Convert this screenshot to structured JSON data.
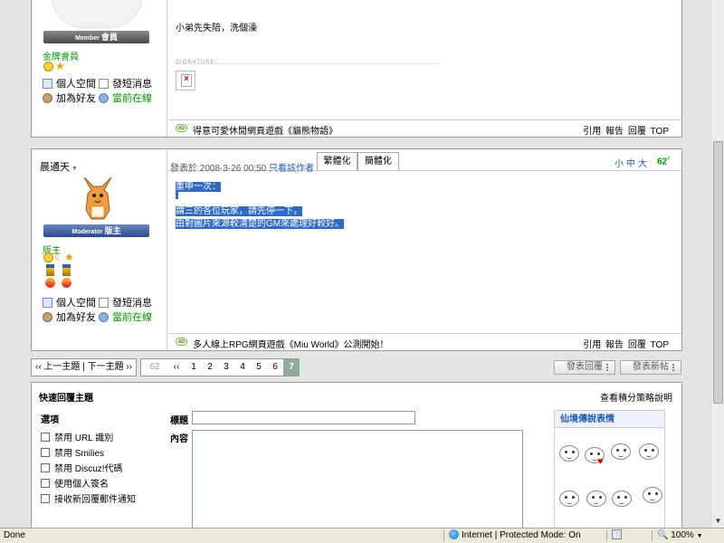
{
  "post1": {
    "rank_title": "Member",
    "rank_label": "會員",
    "group": "金牌會員",
    "links": {
      "space": "個人空間",
      "pm": "發短消息",
      "add_friend": "加為好友",
      "online": "當前在線"
    },
    "message": "小弟先失陪，洗個澡",
    "signature_label": "SIGNATURE:",
    "ad_text": "得意可愛休閒網頁遊戲《貓熊物語》",
    "actions": [
      "引用",
      "報告",
      "回覆",
      "TOP"
    ]
  },
  "post2": {
    "author": "晨通天",
    "rank_title": "Moderator",
    "rank_label": "版主",
    "group": "版主",
    "posted_prefix": "發表於",
    "posted_time": "2008-3-26 00:50",
    "only_author": "只看該作者",
    "tab_trad": "繁體化",
    "tab_simp": "簡體化",
    "size_links": [
      "小",
      "中",
      "大"
    ],
    "floor": "62",
    "floor_sup": "#",
    "lines": [
      "重申一次：",
      "",
      "謂三的各位玩家，請先停一下，",
      "由對圖片來源較清楚的GM來處理好較好。"
    ],
    "links": {
      "space": "個人空間",
      "pm": "發短消息",
      "add_friend": "加為好友",
      "online": "當前在線"
    },
    "ad_text": "多人線上RPG網頁遊戲《Miu World》公測開始！",
    "actions": [
      "引用",
      "報告",
      "回覆",
      "TOP"
    ]
  },
  "pager": {
    "prev_next": "‹‹ 上一主題 | 下一主題 ››",
    "total": "62",
    "first": "‹‹",
    "pages": [
      "1",
      "2",
      "3",
      "4",
      "5",
      "6",
      "7"
    ],
    "current": "7",
    "reply_btn": "發表回覆",
    "new_btn": "發表新帖"
  },
  "quick_reply": {
    "title": "快速回覆主題",
    "help": "查看積分策略說明",
    "options_heading": "選項",
    "options": [
      "禁用 URL 識別",
      "禁用 Smilies",
      "禁用 Discuz!代碼",
      "使用個人簽名",
      "接收新回覆郵件通知"
    ],
    "subject_label": "標題",
    "content_label": "內容",
    "smilies_title": "仙境傳說表情"
  },
  "statusbar": {
    "left": "Done",
    "zone": "Internet | Protected Mode: On",
    "zoom": "100%"
  },
  "colors": {
    "accent": "#1e5ab4",
    "green": "#009900",
    "selection": "#316ac5"
  }
}
